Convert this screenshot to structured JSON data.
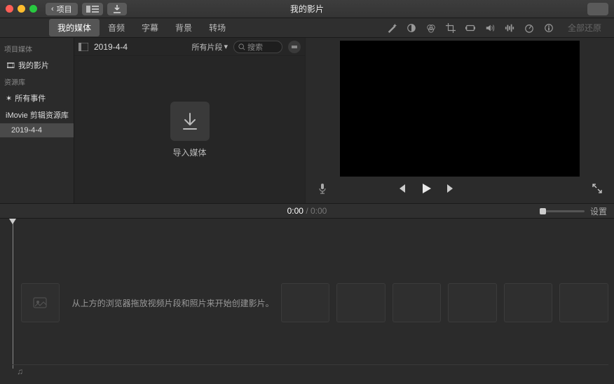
{
  "window": {
    "back_label": "项目",
    "title": "我的影片"
  },
  "tabs": {
    "my_media": "我的媒体",
    "audio": "音频",
    "titles": "字幕",
    "backgrounds": "背景",
    "transitions": "转场"
  },
  "viewer": {
    "reset_all": "全部还原"
  },
  "sidebar": {
    "section_project": "项目媒体",
    "my_movie": "我的影片",
    "section_library": "资源库",
    "all_events": "所有事件",
    "library_name": "iMovie 剪辑资源库",
    "event_date": "2019-4-4"
  },
  "browser": {
    "event_name": "2019-4-4",
    "clip_filter": "所有片段",
    "search_placeholder": "搜索",
    "import_label": "导入媒体"
  },
  "timeline": {
    "current": "0:00",
    "duration": "0:00",
    "settings": "设置",
    "hint": "从上方的浏览器拖放视频片段和照片来开始创建影片。"
  }
}
